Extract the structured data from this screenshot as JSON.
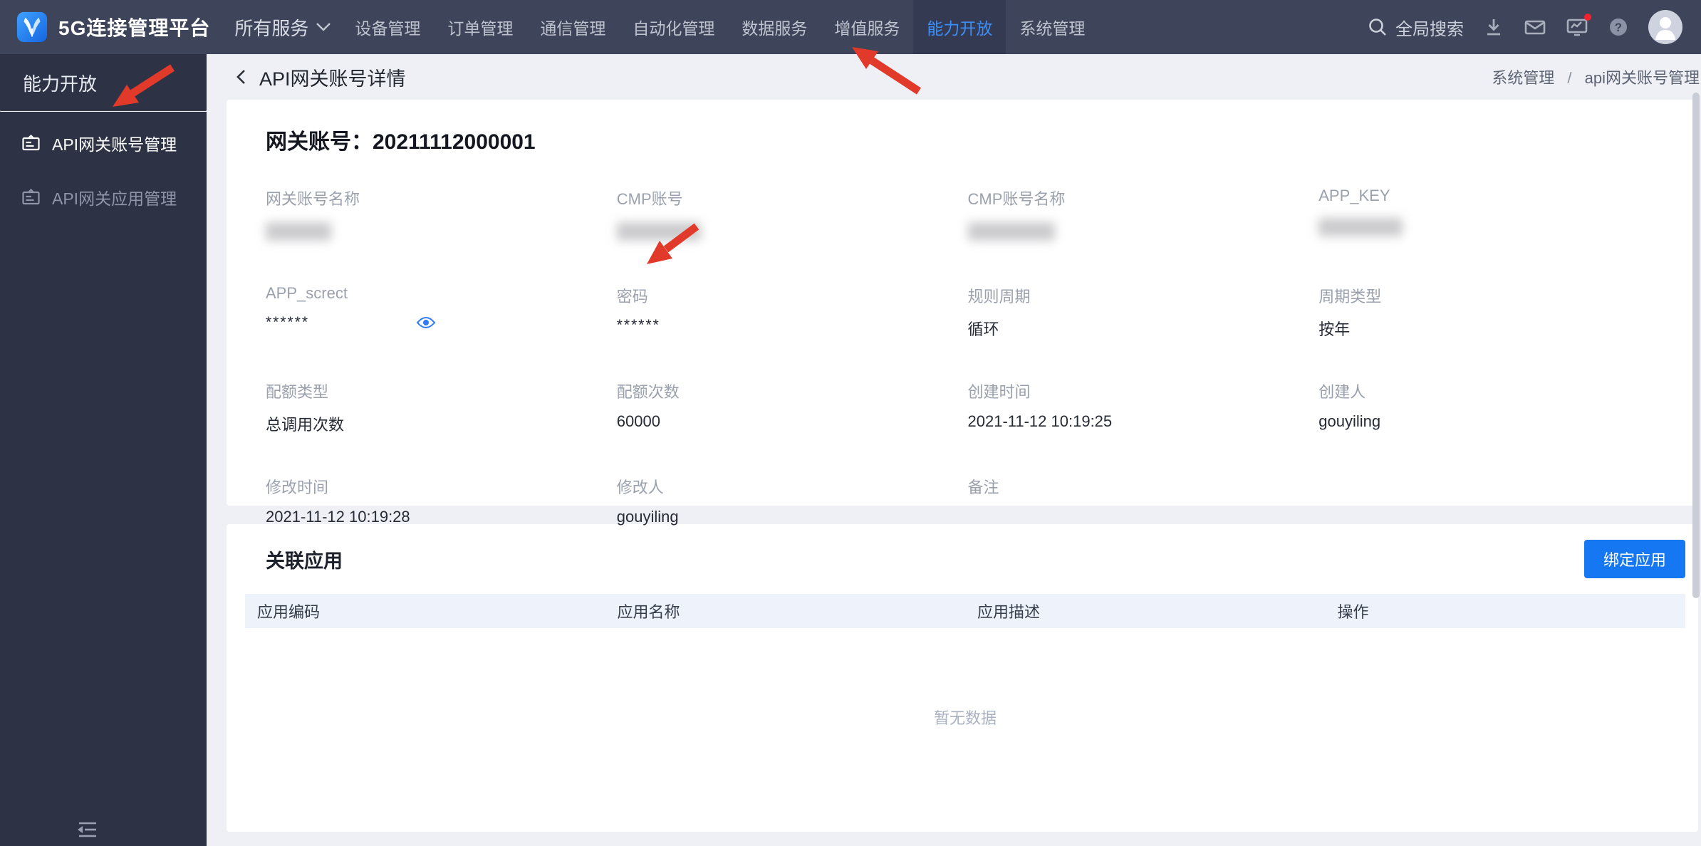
{
  "colors": {
    "nav_bg": "#3e4459",
    "nav_active_bg": "#343a52",
    "accent_blue": "#3e8ef7",
    "sidebar_bg": "#2d3245",
    "page_bg": "#eef0f5",
    "button_blue": "#1677f2",
    "table_header_bg": "#edf2fb",
    "annotation_red": "#e23a2a"
  },
  "topnav": {
    "logo_title": "5G连接管理平台",
    "items": [
      {
        "label": "所有服务",
        "dropdown": true,
        "active": false
      },
      {
        "label": "设备管理",
        "active": false
      },
      {
        "label": "订单管理",
        "active": false
      },
      {
        "label": "通信管理",
        "active": false
      },
      {
        "label": "自动化管理",
        "active": false
      },
      {
        "label": "数据服务",
        "active": false
      },
      {
        "label": "增值服务",
        "active": false
      },
      {
        "label": "能力开放",
        "active": true
      },
      {
        "label": "系统管理",
        "active": false
      }
    ],
    "search_label": "全局搜索",
    "notification_badge": true
  },
  "sidebar": {
    "title": "能力开放",
    "items": [
      {
        "label": "API网关账号管理",
        "active": true
      },
      {
        "label": "API网关应用管理",
        "active": false
      }
    ]
  },
  "page_header": {
    "title": "API网关账号详情",
    "breadcrumb": {
      "parent": "系统管理",
      "separator": "/",
      "current": "api网关账号管理"
    }
  },
  "detail": {
    "account_label": "网关账号：",
    "account_number": "20211112000001",
    "fields": [
      {
        "label": "网关账号名称",
        "value": "",
        "redacted": true
      },
      {
        "label": "CMP账号",
        "value": "",
        "redacted": true
      },
      {
        "label": "CMP账号名称",
        "value": "",
        "redacted": true
      },
      {
        "label": "APP_KEY",
        "value": "",
        "redacted": true
      },
      {
        "label": "APP_screct",
        "value": "******",
        "masked": true,
        "has_eye_toggle": true
      },
      {
        "label": "密码",
        "value": "******",
        "masked": true
      },
      {
        "label": "规则周期",
        "value": "循环"
      },
      {
        "label": "周期类型",
        "value": "按年"
      },
      {
        "label": "配额类型",
        "value": "总调用次数"
      },
      {
        "label": "配额次数",
        "value": "60000"
      },
      {
        "label": "创建时间",
        "value": "2021-11-12 10:19:25"
      },
      {
        "label": "创建人",
        "value": "gouyiling"
      },
      {
        "label": "修改时间",
        "value": "2021-11-12 10:19:28"
      },
      {
        "label": "修改人",
        "value": "gouyiling"
      },
      {
        "label": "备注",
        "value": ""
      }
    ]
  },
  "related_apps": {
    "title": "关联应用",
    "bind_button_label": "绑定应用",
    "table_headers": [
      "应用编码",
      "应用名称",
      "应用描述",
      "操作"
    ],
    "empty_text": "暂无数据"
  }
}
